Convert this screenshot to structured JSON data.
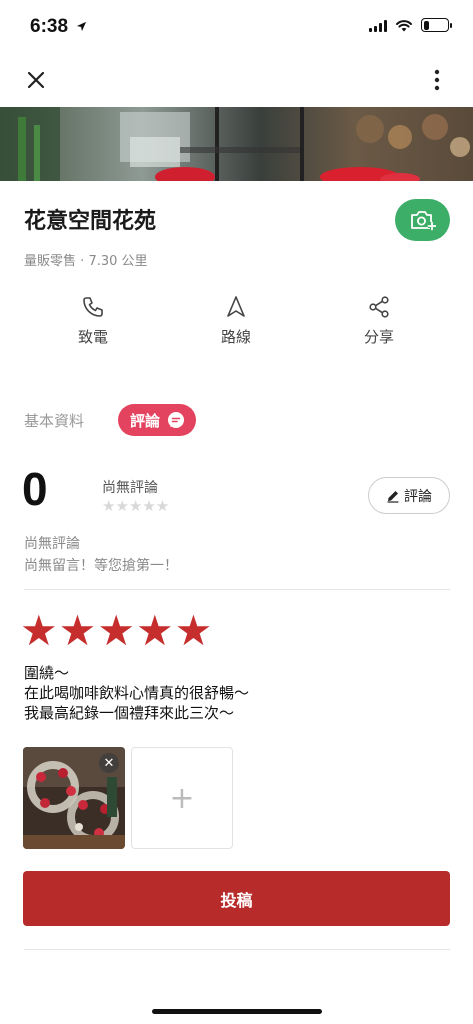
{
  "status_bar": {
    "time": "6:38",
    "battery_level": 0.25,
    "icons": [
      "location-arrow-icon",
      "signal-icon",
      "wifi-icon",
      "battery-icon"
    ]
  },
  "topbar": {
    "icons": [
      "close-icon",
      "more-vertical-icon"
    ]
  },
  "place": {
    "name": "花意空間花苑",
    "category": "量販零售",
    "separator": "·",
    "distance": "7.30 公里"
  },
  "actions": [
    {
      "label": "致電",
      "icon": "phone-icon"
    },
    {
      "label": "路線",
      "icon": "navigation-icon"
    },
    {
      "label": "分享",
      "icon": "share-icon"
    }
  ],
  "tabs": {
    "basic": "基本資料",
    "review": "評論"
  },
  "rating": {
    "value": "0",
    "label": "尚無評論",
    "stars_filled": 0,
    "stars_total": 5,
    "star_glyphs": "★★★★★"
  },
  "review_button": {
    "label": "評論",
    "icon": "pencil-icon"
  },
  "empty_state": {
    "line1": "尚無評論",
    "line2": "尚無留言！等您搶第一！"
  },
  "compose": {
    "selected_stars": 5,
    "star_glyph": "★",
    "text_lines": [
      "圍繞～",
      "在此喝咖啡飲料心情真的很舒暢～",
      "我最高紀錄一個禮拜來此三次～"
    ],
    "add_photo_symbol": "+",
    "remove_symbol": "✕"
  },
  "submit": {
    "label": "投稿"
  },
  "colors": {
    "accent_red": "#b82b2b",
    "star_red": "#c62e2e",
    "tab_pink": "#e4435f",
    "camera_green": "#3dae67"
  }
}
